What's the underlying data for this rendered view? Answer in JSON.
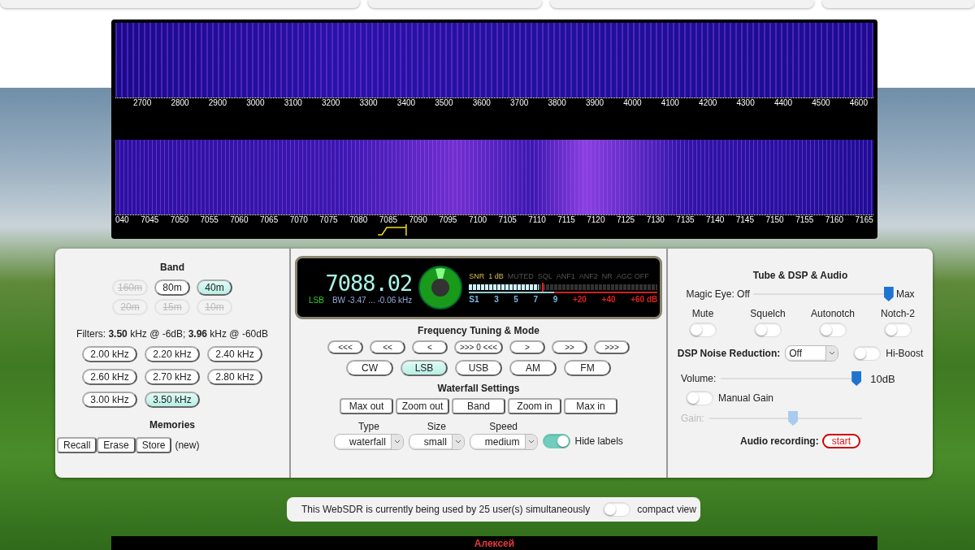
{
  "waterfall": {
    "upper_scale": [
      "2700",
      "2800",
      "2900",
      "3000",
      "3100",
      "3200",
      "3300",
      "3400",
      "3500",
      "3600",
      "3700",
      "3800",
      "3900",
      "4000",
      "4100",
      "4200",
      "4300",
      "4400",
      "4500",
      "4600"
    ],
    "lower_scale": [
      "040",
      "7045",
      "7050",
      "7055",
      "7060",
      "7065",
      "7070",
      "7075",
      "7080",
      "7085",
      "7090",
      "7095",
      "7100",
      "7105",
      "7110",
      "7115",
      "7120",
      "7125",
      "7130",
      "7135",
      "7140",
      "7145",
      "7150",
      "7155",
      "7160",
      "7165"
    ]
  },
  "band": {
    "title": "Band",
    "buttons": [
      {
        "label": "160m",
        "selected": false,
        "disabled": true
      },
      {
        "label": "80m",
        "selected": false,
        "disabled": false
      },
      {
        "label": "40m",
        "selected": true,
        "disabled": false
      },
      {
        "label": "20m",
        "selected": false,
        "disabled": true
      },
      {
        "label": "15m",
        "selected": false,
        "disabled": true
      },
      {
        "label": "10m",
        "selected": false,
        "disabled": true
      }
    ]
  },
  "filters": {
    "label": "Filters:  **3.50** kHz @ -6dB; **3.96** kHz @ -60dB",
    "buttons": [
      {
        "label": "2.00 kHz",
        "selected": false
      },
      {
        "label": "2.20 kHz",
        "selected": false
      },
      {
        "label": "2.40 kHz",
        "selected": false
      },
      {
        "label": "2.60 kHz",
        "selected": false
      },
      {
        "label": "2.70 kHz",
        "selected": false
      },
      {
        "label": "2.80 kHz",
        "selected": false
      },
      {
        "label": "3.00 kHz",
        "selected": false
      },
      {
        "label": "3.50 kHz",
        "selected": true
      }
    ]
  },
  "memories": {
    "title": "Memories",
    "buttons": [
      "Recall",
      "Erase",
      "Store"
    ],
    "note": "(new)"
  },
  "display": {
    "frequency": "7088.02",
    "mode": "LSB",
    "bandwidth": "BW  -3.47 ... -0.06 kHz",
    "indicators": [
      {
        "label": "SNR",
        "on": true
      },
      {
        "label": "1 dB",
        "on": true
      },
      {
        "label": "MUTED",
        "on": false
      },
      {
        "label": "SQL",
        "on": false
      },
      {
        "label": "ANF1",
        "on": false
      },
      {
        "label": "ANF2",
        "on": false
      },
      {
        "label": "NR",
        "on": false
      },
      {
        "label": "AGC OFF",
        "on": false
      }
    ],
    "s_meter": {
      "level": 0.37
    },
    "scale": [
      {
        "label": "S1",
        "kind": "s"
      },
      {
        "label": "3",
        "kind": "s"
      },
      {
        "label": "5",
        "kind": "s"
      },
      {
        "label": "7",
        "kind": "s"
      },
      {
        "label": "9",
        "kind": "s"
      },
      {
        "label": "+20",
        "kind": "over"
      },
      {
        "label": "+40",
        "kind": "over"
      },
      {
        "label": "+60 dB",
        "kind": "over"
      }
    ]
  },
  "tuning": {
    "title": "Frequency Tuning & Mode",
    "steps": [
      "<<<",
      "<<",
      "<",
      ">>> 0 <<<",
      ">",
      ">>",
      ">>>"
    ],
    "modes": [
      {
        "label": "CW",
        "selected": false
      },
      {
        "label": "LSB",
        "selected": true
      },
      {
        "label": "USB",
        "selected": false
      },
      {
        "label": "AM",
        "selected": false
      },
      {
        "label": "FM",
        "selected": false
      }
    ]
  },
  "waterfall_settings": {
    "title": "Waterfall Settings",
    "buttons": [
      "Max out",
      "Zoom out",
      "Band",
      "Zoom in",
      "Max in"
    ],
    "selects": [
      {
        "label": "Type",
        "value": "waterfall"
      },
      {
        "label": "Size",
        "value": "small"
      },
      {
        "label": "Speed",
        "value": "medium"
      }
    ],
    "hide_labels": {
      "label": "Hide labels",
      "on": true
    }
  },
  "audio": {
    "title": "Tube & DSP & Audio",
    "magic_eye": {
      "label": "Magic Eye: Off",
      "max_label": "Max",
      "level": 0.97
    },
    "toggles": [
      {
        "label": "Mute",
        "on": false
      },
      {
        "label": "Squelch",
        "on": false
      },
      {
        "label": "Autonotch",
        "on": false
      },
      {
        "label": "Notch-2",
        "on": false
      }
    ],
    "noise_reduction": {
      "label": "DSP Noise Reduction:",
      "value": "Off"
    },
    "hi_boost": {
      "label": "Hi-Boost",
      "on": false
    },
    "volume": {
      "label": "Volume:",
      "level": 0.97,
      "reading": "10dB"
    },
    "manual_gain": {
      "label": "Manual Gain",
      "on": false
    },
    "gain": {
      "label": "Gain:",
      "level": 0.55,
      "disabled": true
    },
    "recording": {
      "label": "Audio recording:",
      "button": "start"
    }
  },
  "status": {
    "text": "This WebSDR is currently being used by 25 user(s) simultaneously",
    "compact_view": {
      "label": "compact view",
      "on": false
    }
  },
  "footer": {
    "name": "Алексей"
  }
}
